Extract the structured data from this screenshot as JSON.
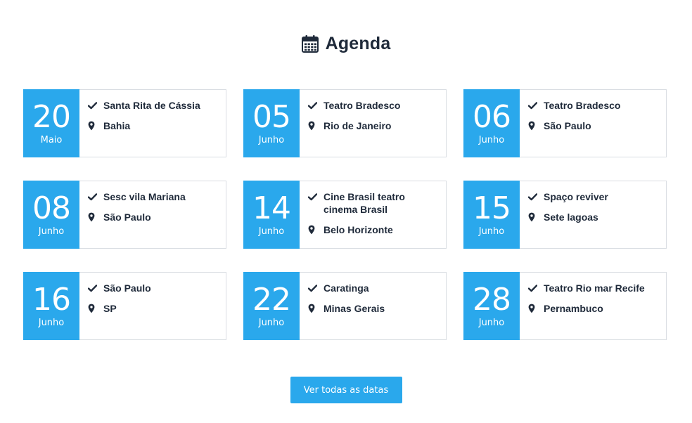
{
  "header": {
    "title": "Agenda",
    "icon": "calendar-icon"
  },
  "colors": {
    "accent": "#2aa8ec",
    "text": "#1f2a3a",
    "border": "#d9dde2"
  },
  "events": [
    {
      "day": "20",
      "month": "Maio",
      "venue": "Santa Rita de Cássia",
      "location": "Bahia"
    },
    {
      "day": "05",
      "month": "Junho",
      "venue": "Teatro Bradesco",
      "location": "Rio de Janeiro"
    },
    {
      "day": "06",
      "month": "Junho",
      "venue": "Teatro Bradesco",
      "location": "São Paulo"
    },
    {
      "day": "08",
      "month": "Junho",
      "venue": "Sesc vila Mariana",
      "location": "São Paulo"
    },
    {
      "day": "14",
      "month": "Junho",
      "venue": "Cine Brasil teatro cinema Brasil",
      "location": "Belo Horizonte"
    },
    {
      "day": "15",
      "month": "Junho",
      "venue": "Spaço reviver",
      "location": "Sete lagoas"
    },
    {
      "day": "16",
      "month": "Junho",
      "venue": "São Paulo",
      "location": "SP"
    },
    {
      "day": "22",
      "month": "Junho",
      "venue": "Caratinga",
      "location": "Minas Gerais"
    },
    {
      "day": "28",
      "month": "Junho",
      "venue": "Teatro Rio mar Recife",
      "location": "Pernambuco"
    }
  ],
  "icons": {
    "venue": "check-icon",
    "location": "map-marker-icon"
  },
  "cta": {
    "label": "Ver todas as datas"
  }
}
